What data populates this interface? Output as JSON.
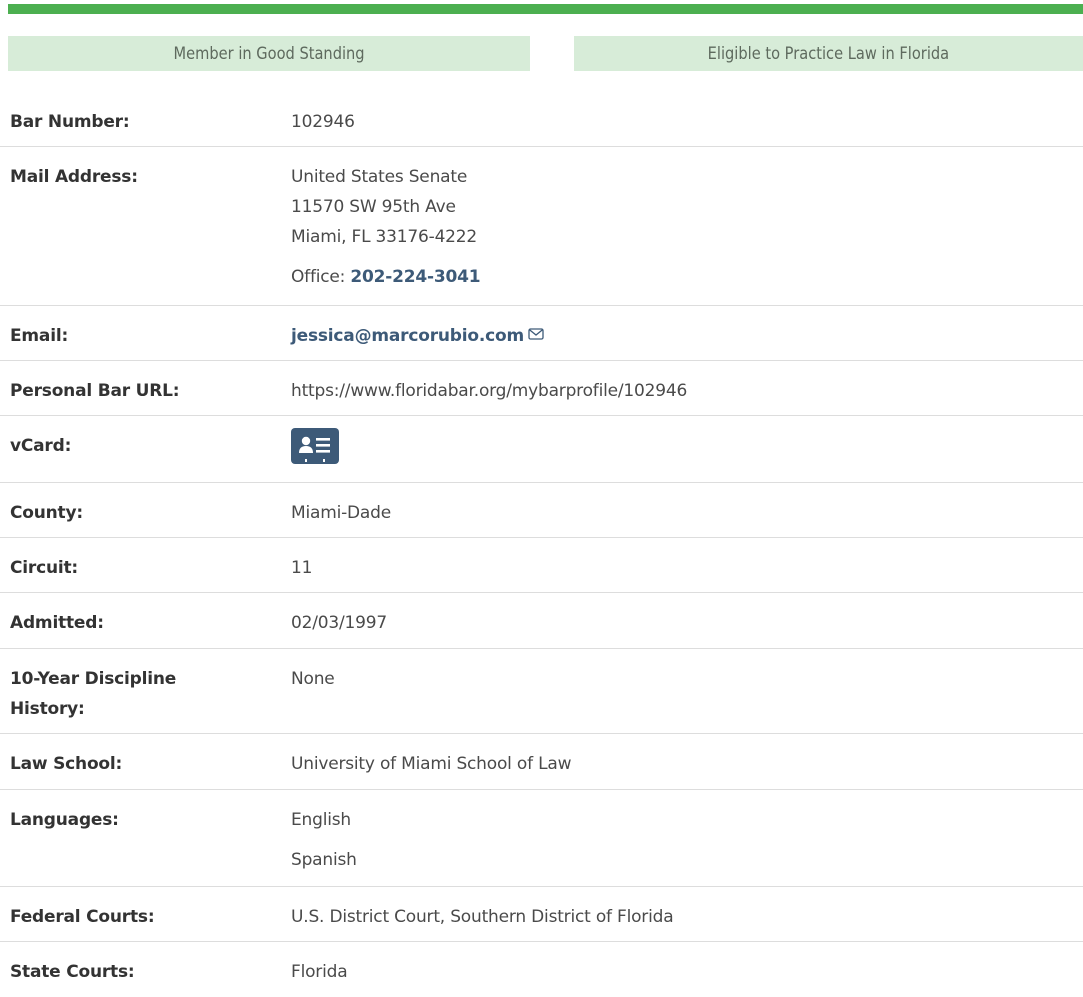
{
  "status": {
    "standing": "Member in Good Standing",
    "eligibility": "Eligible to Practice Law in Florida"
  },
  "colors": {
    "accent_bar": "#4caf50",
    "badge_bg": "#d7ecd8",
    "link": "#3d5a78"
  },
  "profile": {
    "bar_number": {
      "label": "Bar Number:",
      "value": "102946"
    },
    "mail_address": {
      "label": "Mail Address:",
      "lines": [
        "United States Senate",
        "11570 SW 95th Ave",
        "Miami, FL 33176-4222"
      ],
      "office_label": "Office: ",
      "office_phone": "202-224-3041"
    },
    "email": {
      "label": "Email:",
      "value": "jessica@marcorubio.com",
      "icon": "envelope-icon"
    },
    "personal_url": {
      "label": "Personal Bar URL:",
      "value": "https://www.floridabar.org/mybarprofile/102946"
    },
    "vcard": {
      "label": "vCard:",
      "icon": "vcard-icon"
    },
    "county": {
      "label": "County:",
      "value": "Miami-Dade"
    },
    "circuit": {
      "label": "Circuit:",
      "value": "11"
    },
    "admitted": {
      "label": "Admitted:",
      "value": "02/03/1997"
    },
    "discipline": {
      "label_line1": "10-Year Discipline",
      "label_line2": "History:",
      "value": "None"
    },
    "law_school": {
      "label": "Law School:",
      "value": "University of Miami School of Law"
    },
    "languages": {
      "label": "Languages:",
      "values": [
        "English",
        "Spanish"
      ]
    },
    "federal_courts": {
      "label": "Federal Courts:",
      "value": "U.S. District Court, Southern District of Florida"
    },
    "state_courts": {
      "label": "State Courts:",
      "value": "Florida"
    }
  }
}
